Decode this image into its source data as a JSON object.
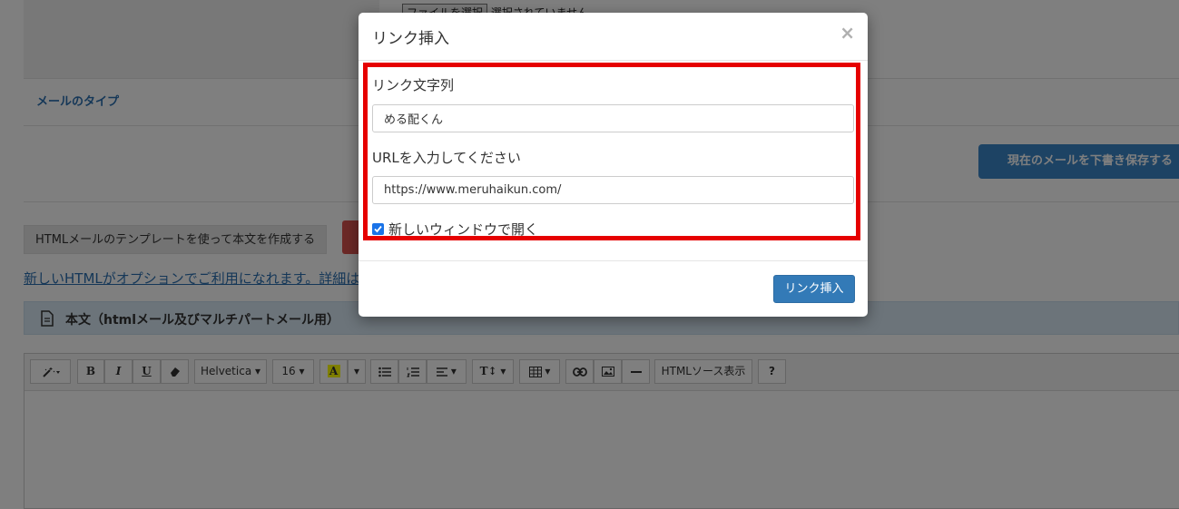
{
  "background": {
    "file_select": {
      "button_label": "ファイルを選択",
      "status_text": "選択されていません"
    },
    "mail_type_label": "メールのタイプ",
    "save_draft_label": "現在のメールを下書き保存する",
    "template_button_label": "HTMLメールのテンプレートを使って本文を作成する",
    "option_link_text": "新しいHTMLがオプションでご利用になれます。詳細は",
    "body_section_title": "本文（htmlメール及びマルチパートメール用）",
    "toolbar": {
      "font_family": "Helvetica",
      "font_size": "16",
      "html_source_label": "HTMLソース表示",
      "help_label": "?",
      "color_label": "A"
    }
  },
  "modal": {
    "title": "リンク挿入",
    "close_symbol": "×",
    "link_text_label": "リンク文字列",
    "link_text_value": "める配くん",
    "url_label": "URLを入力してください",
    "url_value": "https://www.meruhaikun.com/",
    "new_window_label": "新しいウィンドウで開く",
    "new_window_checked": true,
    "insert_button_label": "リンク挿入"
  },
  "colors": {
    "primary_button": "#337ab7",
    "highlight_border": "#e60000",
    "link": "#2a6fb0"
  }
}
